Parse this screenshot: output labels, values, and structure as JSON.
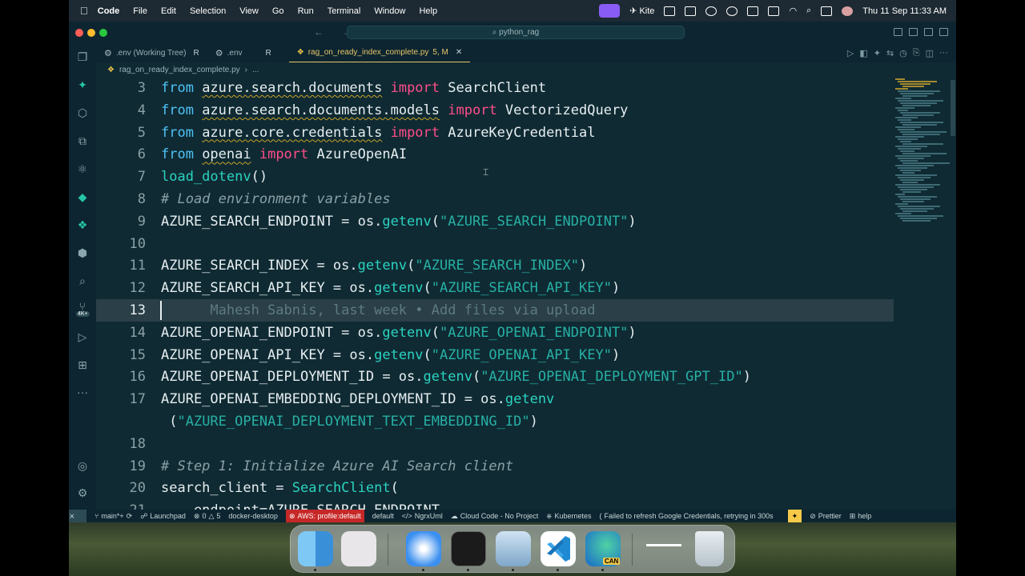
{
  "menubar": {
    "app": "Code",
    "items": [
      "File",
      "Edit",
      "Selection",
      "View",
      "Go",
      "Run",
      "Terminal",
      "Window",
      "Help"
    ],
    "kite": "Kite",
    "datetime": "Thu 11 Sep  11:33 AM"
  },
  "window": {
    "search_text": "python_rag"
  },
  "tabs": [
    {
      "label": ".env (Working Tree)",
      "flag": "R"
    },
    {
      "label": ".env",
      "flag": "R"
    },
    {
      "label": "rag_on_ready_index_complete.py",
      "flag": "5, M"
    }
  ],
  "breadcrumb": {
    "file": "rag_on_ready_index_complete.py",
    "rest": "..."
  },
  "editor": {
    "lines": [
      {
        "n": "3",
        "parts": [
          [
            "kw",
            "from "
          ],
          [
            "sq",
            "azure.search.documents"
          ],
          [
            "imp",
            " import "
          ],
          [
            "pl",
            "SearchClient"
          ]
        ]
      },
      {
        "n": "4",
        "parts": [
          [
            "kw",
            "from "
          ],
          [
            "sq",
            "azure.search.documents.models"
          ],
          [
            "imp",
            " import "
          ],
          [
            "pl",
            "VectorizedQuery"
          ]
        ]
      },
      {
        "n": "5",
        "parts": [
          [
            "kw",
            "from "
          ],
          [
            "sq",
            "azure.core.credentials"
          ],
          [
            "imp",
            " import "
          ],
          [
            "pl",
            "AzureKeyCredential"
          ]
        ]
      },
      {
        "n": "6",
        "parts": [
          [
            "kw",
            "from "
          ],
          [
            "sq",
            "openai"
          ],
          [
            "imp",
            " import "
          ],
          [
            "pl",
            "AzureOpenAI"
          ]
        ]
      },
      {
        "n": "7",
        "parts": [
          [
            "fn",
            "load_dotenv"
          ],
          [
            "pl",
            "()"
          ]
        ]
      },
      {
        "n": "8",
        "parts": [
          [
            "cm",
            "# Load environment variables"
          ]
        ]
      },
      {
        "n": "9",
        "parts": [
          [
            "pl",
            "AZURE_SEARCH_ENDPOINT = os."
          ],
          [
            "fn",
            "getenv"
          ],
          [
            "pl",
            "("
          ],
          [
            "str",
            "\"AZURE_SEARCH_ENDPOINT\""
          ],
          [
            "pl",
            ")"
          ]
        ]
      },
      {
        "n": "10",
        "parts": []
      },
      {
        "n": "11",
        "parts": [
          [
            "pl",
            "AZURE_SEARCH_INDEX = os."
          ],
          [
            "fn",
            "getenv"
          ],
          [
            "pl",
            "("
          ],
          [
            "str",
            "\"AZURE_SEARCH_INDEX\""
          ],
          [
            "pl",
            ")"
          ]
        ]
      },
      {
        "n": "12",
        "parts": [
          [
            "pl",
            "AZURE_SEARCH_API_KEY = os."
          ],
          [
            "fn",
            "getenv"
          ],
          [
            "pl",
            "("
          ],
          [
            "str",
            "\"AZURE_SEARCH_API_KEY\""
          ],
          [
            "pl",
            ")"
          ]
        ]
      },
      {
        "n": "13",
        "parts": [
          [
            "bl",
            "      Mahesh Sabnis, last week • Add files via upload"
          ]
        ],
        "current": true
      },
      {
        "n": "14",
        "parts": [
          [
            "pl",
            "AZURE_OPENAI_ENDPOINT = os."
          ],
          [
            "fn",
            "getenv"
          ],
          [
            "pl",
            "("
          ],
          [
            "str",
            "\"AZURE_OPENAI_ENDPOINT\""
          ],
          [
            "pl",
            ")"
          ]
        ]
      },
      {
        "n": "15",
        "parts": [
          [
            "pl",
            "AZURE_OPENAI_API_KEY = os."
          ],
          [
            "fn",
            "getenv"
          ],
          [
            "pl",
            "("
          ],
          [
            "str",
            "\"AZURE_OPENAI_API_KEY\""
          ],
          [
            "pl",
            ")"
          ]
        ]
      },
      {
        "n": "16",
        "parts": [
          [
            "pl",
            "AZURE_OPENAI_DEPLOYMENT_ID = os."
          ],
          [
            "fn",
            "getenv"
          ],
          [
            "pl",
            "("
          ],
          [
            "str",
            "\"AZURE_OPENAI_DEPLOYMENT_GPT_ID\""
          ],
          [
            "pl",
            ")"
          ]
        ]
      },
      {
        "n": "17",
        "parts": [
          [
            "pl",
            "AZURE_OPENAI_EMBEDDING_DEPLOYMENT_ID = os."
          ],
          [
            "fn",
            "getenv"
          ]
        ]
      },
      {
        "n": "",
        "parts": [
          [
            "pl",
            " ("
          ],
          [
            "str",
            "\"AZURE_OPENAI_DEPLOYMENT_TEXT_EMBEDDING_ID\""
          ],
          [
            "pl",
            ")"
          ]
        ]
      },
      {
        "n": "18",
        "parts": []
      },
      {
        "n": "19",
        "parts": [
          [
            "cm",
            "# Step 1: Initialize Azure AI Search client"
          ]
        ]
      },
      {
        "n": "20",
        "parts": [
          [
            "pl",
            "search_client = "
          ],
          [
            "fn",
            "SearchClient"
          ],
          [
            "pl",
            "("
          ]
        ]
      },
      {
        "n": "21",
        "parts": [
          [
            "pl",
            "    endpoint=AZURE_SEARCH_ENDPOINT,"
          ]
        ]
      }
    ]
  },
  "statusbar": {
    "branch": "main*+",
    "launchpad": "Launchpad",
    "problems": "0 △ 5",
    "errors": "0",
    "warnings": "5",
    "docker": "docker-desktop",
    "aws": "AWS: profile:default",
    "default": "default",
    "ngrx": "NgrxUml",
    "cloudcode": "Cloud Code - No Project",
    "kubernetes": "Kubernetes",
    "google": "Failed to refresh Google Credentials, retrying in 300s",
    "prettier": "Prettier",
    "help": "help"
  },
  "dock": {
    "edge_badge": "CAN"
  },
  "colors": {
    "editor_bg": "#0f2a33",
    "keyword": "#4fc3f7",
    "import": "#ff4d8a",
    "function": "#2bd3c0",
    "string": "#27b0a4",
    "aws_badge": "#c62828"
  }
}
